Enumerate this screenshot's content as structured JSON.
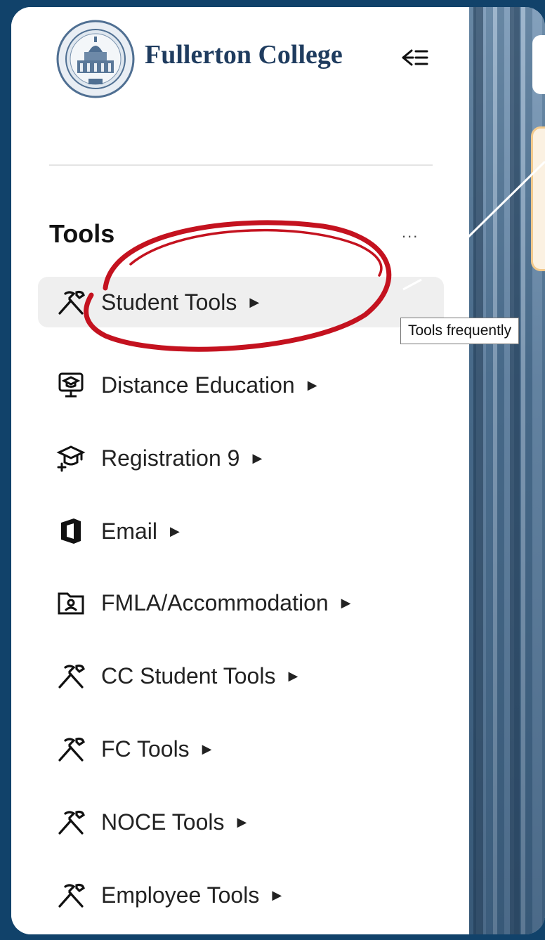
{
  "app": {
    "college_name": "Fullerton College"
  },
  "header": {
    "collapse_icon": "collapse-sidebar-icon"
  },
  "sidebar": {
    "section_title": "Tools",
    "more_label": "...",
    "items": [
      {
        "label": "Student Tools",
        "icon": "tools-icon"
      },
      {
        "label": "Distance Education",
        "icon": "monitor-graduation-icon"
      },
      {
        "label": "Registration 9",
        "icon": "graduation-cap-plus-icon"
      },
      {
        "label": "Email",
        "icon": "office-icon"
      },
      {
        "label": "FMLA/Accommodation",
        "icon": "folder-person-icon"
      },
      {
        "label": "CC Student Tools",
        "icon": "tools-icon"
      },
      {
        "label": "FC Tools",
        "icon": "tools-icon"
      },
      {
        "label": "NOCE Tools",
        "icon": "tools-icon"
      },
      {
        "label": "Employee Tools",
        "icon": "tools-icon"
      }
    ]
  },
  "tooltip": {
    "text": "Tools frequently"
  },
  "colors": {
    "page_bg": "#11426a",
    "highlight": "#c4121f",
    "active_item_bg": "#efefef"
  }
}
